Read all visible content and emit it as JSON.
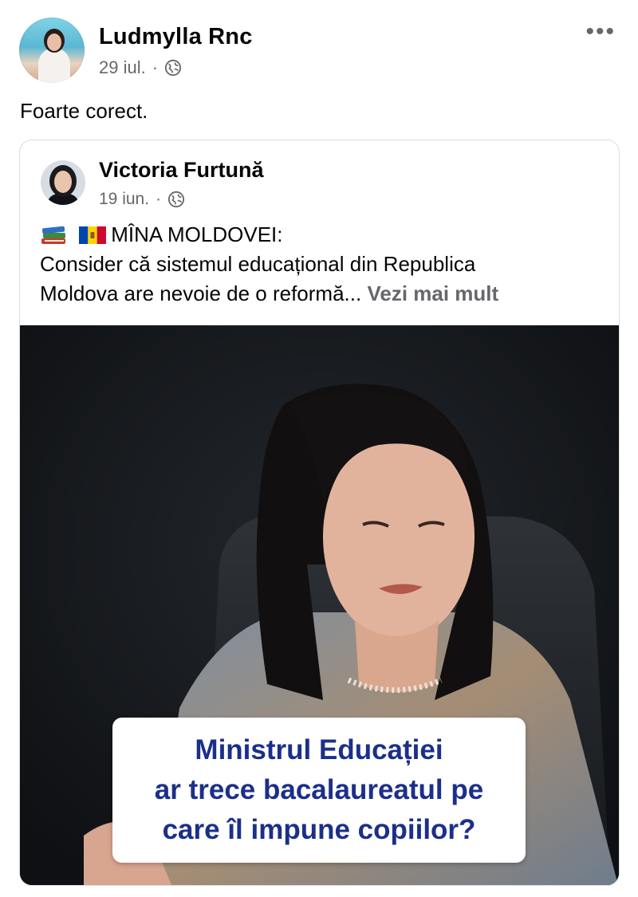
{
  "post": {
    "author": "Ludmylla Rnc",
    "date": "29 iul.",
    "separator": "·",
    "privacy_icon": "globe-icon",
    "more_label": "•••",
    "text": "Foarte corect."
  },
  "shared_post": {
    "author": "Victoria Furtună",
    "date": "19 iun.",
    "separator": "·",
    "privacy_icon": "globe-icon",
    "line1": "MÎNA MOLDOVEI:",
    "line2": "Consider că sistemul educațional din Republica",
    "line3": "Moldova are nevoie de o reformă...",
    "see_more": "Vezi mai mult",
    "emojis": [
      "books-icon",
      "moldova-flag-icon"
    ]
  },
  "video": {
    "caption_lines": [
      "Ministrul Educației",
      "ar trece bacalaureatul pe",
      "care îl impune copiilor?"
    ]
  },
  "colors": {
    "secondary_text": "#65676b",
    "caption_text": "#1b2f8a",
    "card_border": "#dadde1"
  }
}
